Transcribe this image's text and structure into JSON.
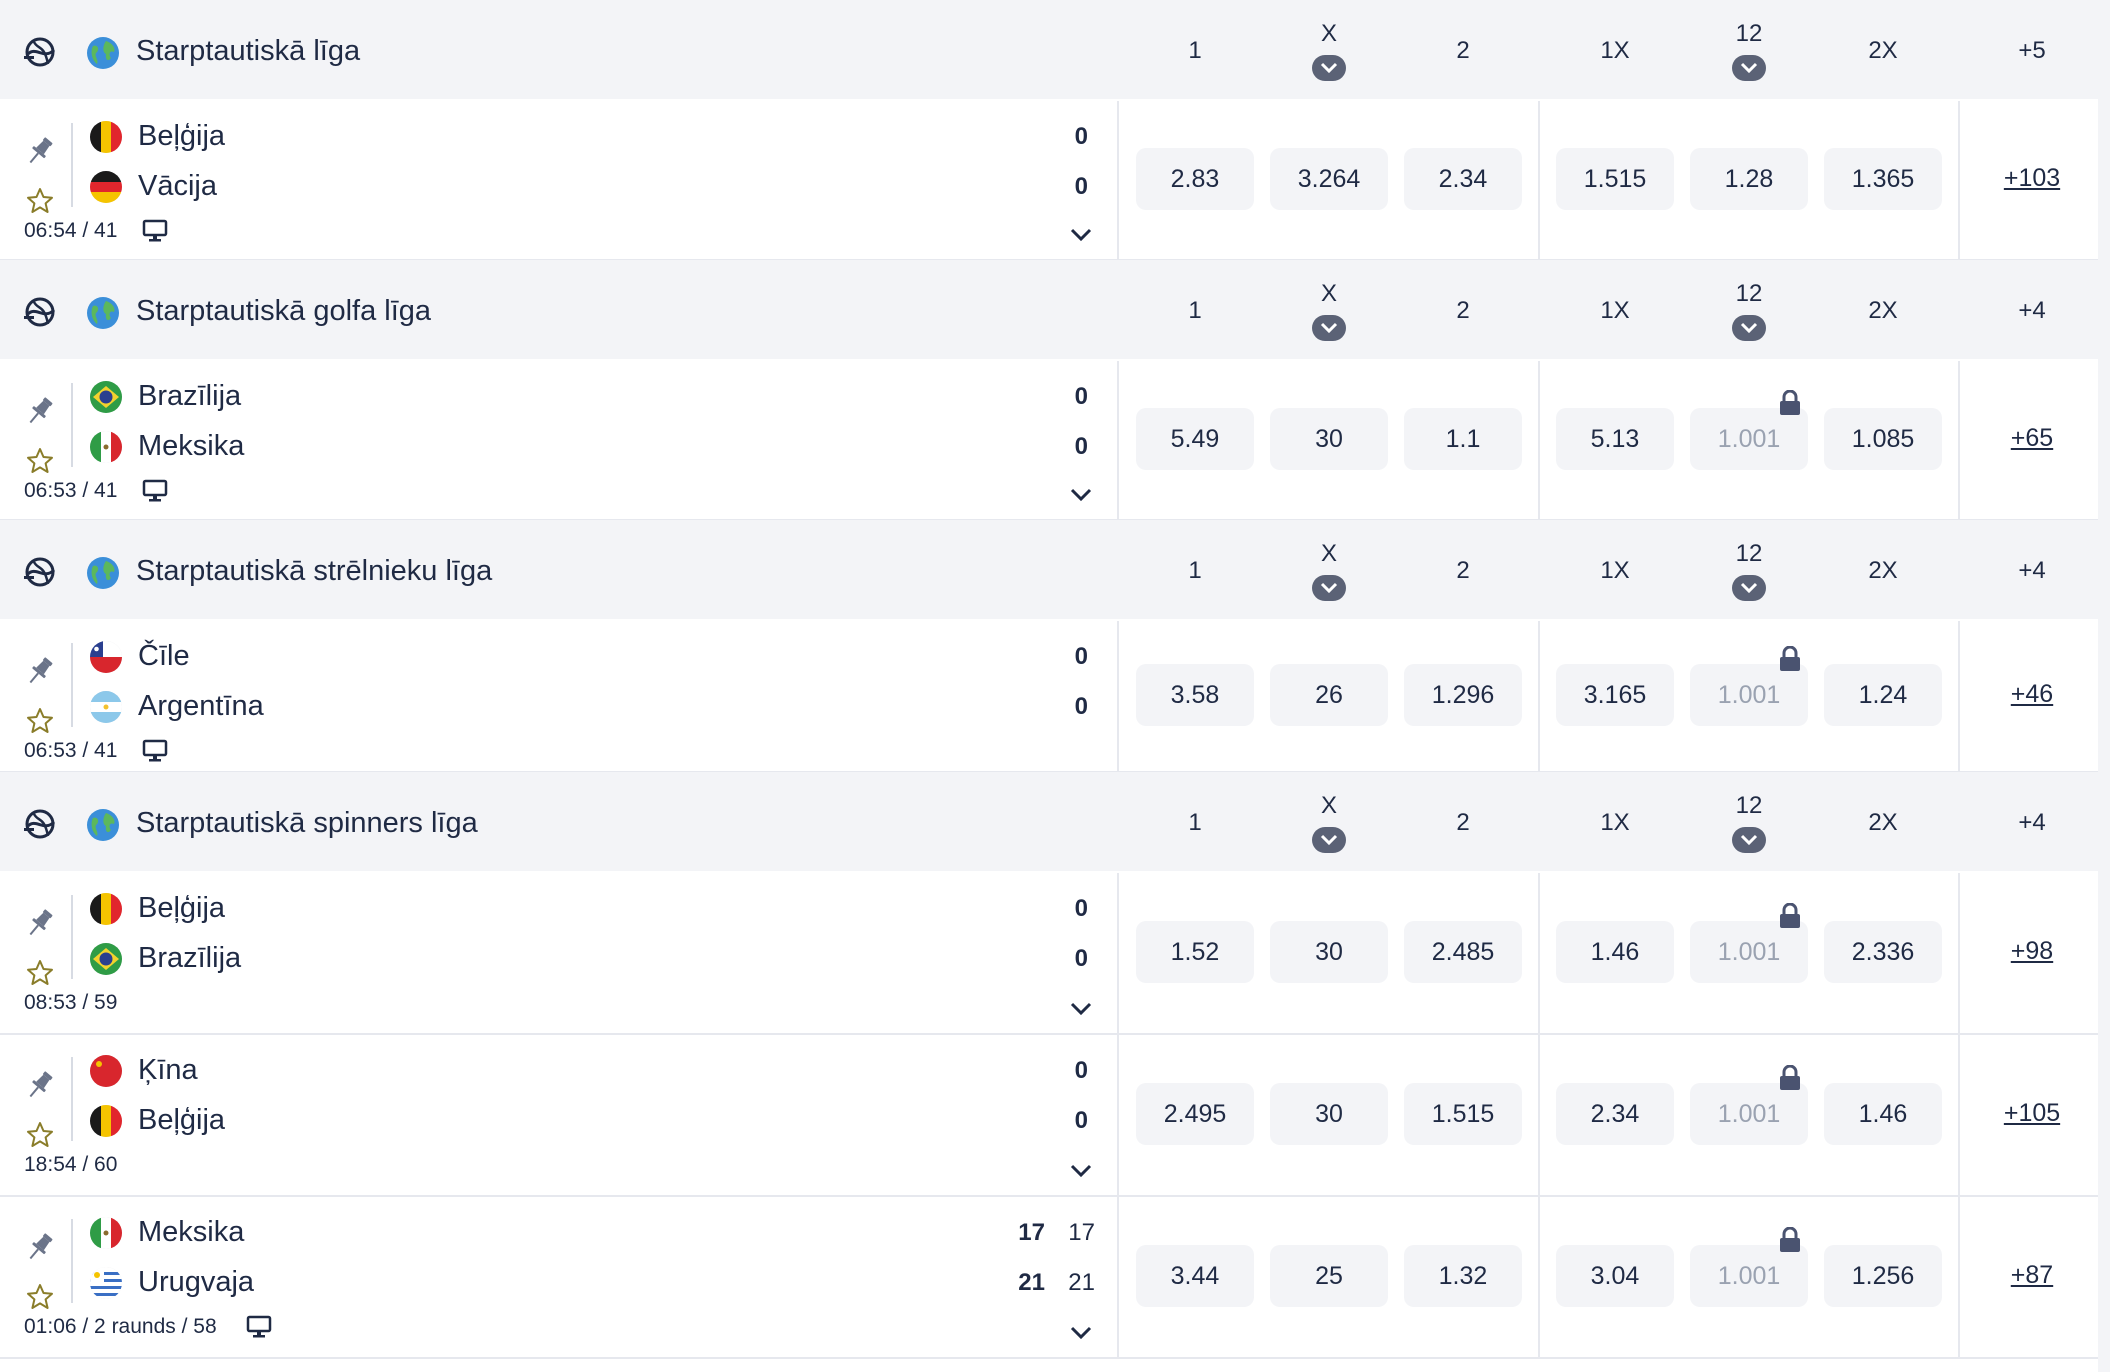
{
  "market_columns": [
    "1",
    "X",
    "2",
    "1X",
    "12",
    "2X"
  ],
  "sections": [
    {
      "league": "Starptautiskā līga",
      "more_markets": "+5",
      "events": [
        {
          "home": "Beļģija",
          "away": "Vācija",
          "home_flag": "belgium",
          "away_flag": "germany",
          "home_score": "0",
          "away_score": "0",
          "home_score2": "",
          "away_score2": "",
          "time_info": "06:54 / 41",
          "has_tv": true,
          "has_expand": true,
          "odds": [
            {
              "value": "2.83",
              "locked": false
            },
            {
              "value": "3.264",
              "locked": false
            },
            {
              "value": "2.34",
              "locked": false
            },
            {
              "value": "1.515",
              "locked": false
            },
            {
              "value": "1.28",
              "locked": false
            },
            {
              "value": "1.365",
              "locked": false
            }
          ],
          "more_link": "+103"
        }
      ]
    },
    {
      "league": "Starptautiskā golfa līga",
      "more_markets": "+4",
      "events": [
        {
          "home": "Brazīlija",
          "away": "Meksika",
          "home_flag": "brazil",
          "away_flag": "mexico",
          "home_score": "0",
          "away_score": "0",
          "home_score2": "",
          "away_score2": "",
          "time_info": "06:53 / 41",
          "has_tv": true,
          "has_expand": true,
          "odds": [
            {
              "value": "5.49",
              "locked": false
            },
            {
              "value": "30",
              "locked": false
            },
            {
              "value": "1.1",
              "locked": false
            },
            {
              "value": "5.13",
              "locked": false
            },
            {
              "value": "1.001",
              "locked": true
            },
            {
              "value": "1.085",
              "locked": false
            }
          ],
          "more_link": "+65"
        }
      ]
    },
    {
      "league": "Starptautiskā strēlnieku līga",
      "more_markets": "+4",
      "events": [
        {
          "home": "Čīle",
          "away": "Argentīna",
          "home_flag": "chile",
          "away_flag": "argentina",
          "home_score": "0",
          "away_score": "0",
          "home_score2": "",
          "away_score2": "",
          "time_info": "06:53 / 41",
          "has_tv": true,
          "has_expand": false,
          "odds": [
            {
              "value": "3.58",
              "locked": false
            },
            {
              "value": "26",
              "locked": false
            },
            {
              "value": "1.296",
              "locked": false
            },
            {
              "value": "3.165",
              "locked": false
            },
            {
              "value": "1.001",
              "locked": true
            },
            {
              "value": "1.24",
              "locked": false
            }
          ],
          "more_link": "+46"
        }
      ]
    },
    {
      "league": "Starptautiskā spinners līga",
      "more_markets": "+4",
      "events": [
        {
          "home": "Beļģija",
          "away": "Brazīlija",
          "home_flag": "belgium",
          "away_flag": "brazil",
          "home_score": "0",
          "away_score": "0",
          "home_score2": "",
          "away_score2": "",
          "time_info": "08:53 / 59",
          "has_tv": false,
          "has_expand": true,
          "odds": [
            {
              "value": "1.52",
              "locked": false
            },
            {
              "value": "30",
              "locked": false
            },
            {
              "value": "2.485",
              "locked": false
            },
            {
              "value": "1.46",
              "locked": false
            },
            {
              "value": "1.001",
              "locked": true
            },
            {
              "value": "2.336",
              "locked": false
            }
          ],
          "more_link": "+98"
        },
        {
          "home": "Ķīna",
          "away": "Beļģija",
          "home_flag": "china",
          "away_flag": "belgium",
          "home_score": "0",
          "away_score": "0",
          "home_score2": "",
          "away_score2": "",
          "time_info": "18:54 / 60",
          "has_tv": false,
          "has_expand": true,
          "odds": [
            {
              "value": "2.495",
              "locked": false
            },
            {
              "value": "30",
              "locked": false
            },
            {
              "value": "1.515",
              "locked": false
            },
            {
              "value": "2.34",
              "locked": false
            },
            {
              "value": "1.001",
              "locked": true
            },
            {
              "value": "1.46",
              "locked": false
            }
          ],
          "more_link": "+105"
        },
        {
          "home": "Meksika",
          "away": "Urugvaja",
          "home_flag": "mexico",
          "away_flag": "uruguay",
          "home_score": "17",
          "away_score": "21",
          "home_score2": "17",
          "away_score2": "21",
          "time_info": "01:06 / 2 raunds / 58",
          "has_tv": true,
          "has_expand": true,
          "odds": [
            {
              "value": "3.44",
              "locked": false
            },
            {
              "value": "25",
              "locked": false
            },
            {
              "value": "1.32",
              "locked": false
            },
            {
              "value": "3.04",
              "locked": false
            },
            {
              "value": "1.001",
              "locked": true
            },
            {
              "value": "1.256",
              "locked": false
            }
          ],
          "more_link": "+87"
        }
      ]
    }
  ],
  "colors": {
    "primary_text": "#1f2a44",
    "header_bg": "#f3f4f7",
    "odd_bg": "#f3f4f7",
    "locked_text": "#9aa2b1",
    "chevron_bg": "#5b6276"
  },
  "icons": {
    "sport": "sport-icon",
    "globe": "globe-icon",
    "pin": "pin-icon",
    "star": "star-icon",
    "tv": "tv-icon",
    "lock": "lock-icon",
    "expand": "chevron-down-icon"
  }
}
